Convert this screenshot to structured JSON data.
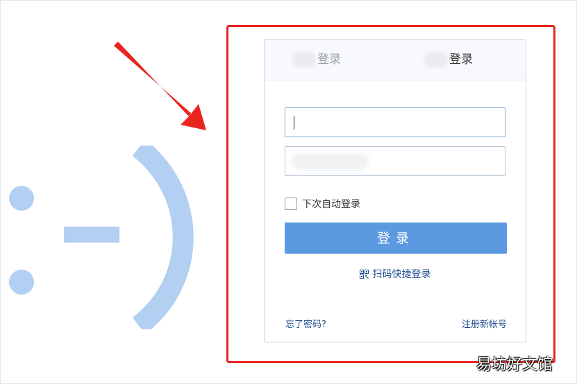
{
  "tabs": [
    {
      "label": "登录",
      "active": false
    },
    {
      "label": "登录",
      "active": true
    }
  ],
  "username": {
    "value": "",
    "placeholder": ""
  },
  "password": {
    "value": "",
    "placeholder": ""
  },
  "remember": {
    "label": "下次自动登录",
    "checked": false
  },
  "login_button": {
    "label": "登录"
  },
  "qr_login": {
    "label": "扫码快捷登录",
    "icon": "qr-code-icon"
  },
  "forgot_password": {
    "label": "忘了密码?"
  },
  "register": {
    "label": "注册新帐号"
  },
  "watermark": "易坊好文馆",
  "colors": {
    "accent": "#5b9ae1",
    "annotation": "#e8251f",
    "smiley": "#b3cff2",
    "link": "#1f4e8f"
  }
}
